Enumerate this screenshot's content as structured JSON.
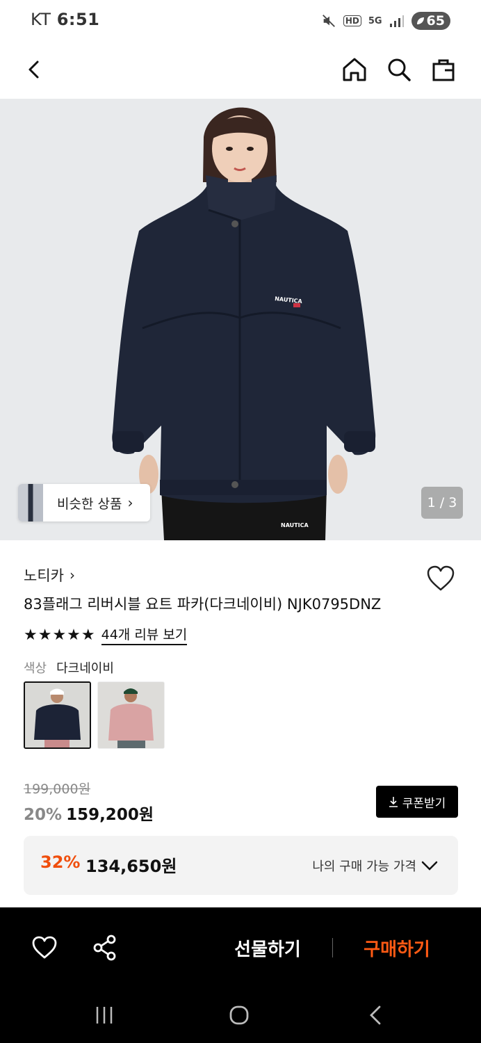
{
  "status_bar": {
    "carrier": "KT",
    "time": "6:51",
    "network": "5G",
    "hd": "HD",
    "battery": "65"
  },
  "nav": {
    "icons": [
      "back-icon",
      "home-icon",
      "search-icon",
      "shopping-bag-icon"
    ]
  },
  "hero": {
    "brand_print": "NAUTICA",
    "similar_label": "비슷한 상품",
    "similar_chevron": "›",
    "page_indicator": "1 / 3"
  },
  "product": {
    "brand": "노티카",
    "brand_chevron": "›",
    "title": "83플래그 리버시블 요트 파카(다크네이비) NJK0795DNZ",
    "stars": "★★★★★",
    "rating_value": 5,
    "review_link": "44개 리뷰 보기",
    "color_key": "색상",
    "color_value": "다크네이비",
    "swatches": [
      "navy",
      "pink"
    ]
  },
  "price": {
    "original": "199,000원",
    "discount": "20%",
    "sale": "159,200원",
    "coupon_button": "쿠폰받기"
  },
  "my_price": {
    "discount": "32%",
    "price": "134,650원",
    "label": "나의 구매 가능 가격"
  },
  "actions": {
    "gift": "선물하기",
    "buy": "구매하기"
  },
  "colors": {
    "accent": "#f04e0c",
    "buy": "#ff5a14",
    "bar": "#000000"
  }
}
